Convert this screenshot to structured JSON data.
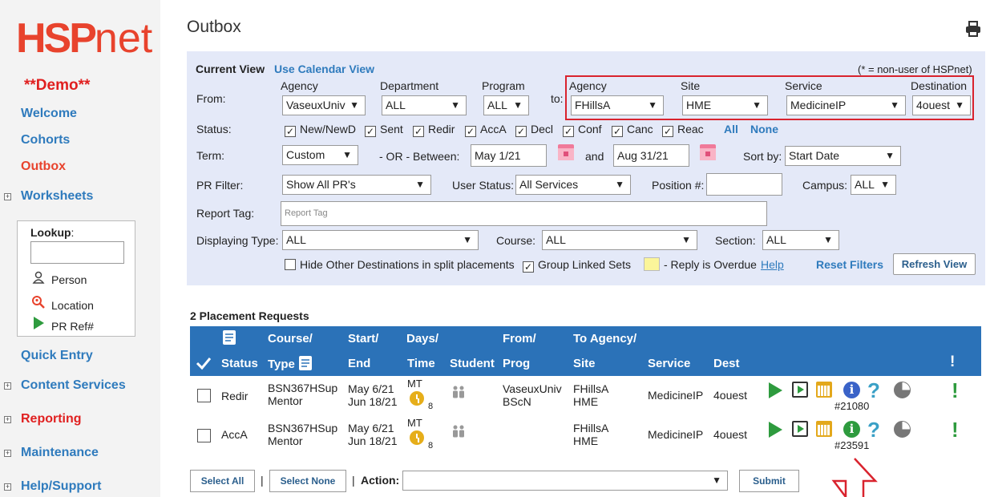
{
  "sidebar": {
    "logo_main": "HSP",
    "logo_net": "net",
    "demo": "**Demo**",
    "nav": {
      "welcome": "Welcome",
      "cohorts": "Cohorts",
      "outbox": "Outbox",
      "worksheets": "Worksheets",
      "quick_entry": "Quick Entry",
      "content_services": "Content Services",
      "reporting": "Reporting",
      "maintenance": "Maintenance",
      "help_support": "Help/Support"
    },
    "lookup": {
      "title": "Lookup",
      "colon": ":",
      "items": [
        "Person",
        "Location",
        "PR Ref#"
      ]
    }
  },
  "page": {
    "title": "Outbox"
  },
  "filters": {
    "current_view": "Current View",
    "calendar_link": "Use Calendar View",
    "non_user_note": "(* = non-user of HSPnet)",
    "from_label": "From:",
    "to_label": "to:",
    "agency_label": "Agency",
    "department_label": "Department",
    "program_label": "Program",
    "to_agency_label": "Agency",
    "site_label": "Site",
    "service_label": "Service",
    "destination_label": "Destination",
    "from_agency": "VaseuxUniv",
    "department": "ALL",
    "program": "ALL",
    "to_agency": "FHillsA",
    "site": "HME",
    "service": "MedicineIP",
    "destination": "4ouest",
    "status_label": "Status:",
    "statuses": [
      "New/NewD",
      "Sent",
      "Redir",
      "AccA",
      "Decl",
      "Conf",
      "Canc",
      "Reac"
    ],
    "all_link": "All",
    "none_link": "None",
    "term_label": "Term:",
    "term": "Custom",
    "or_between": "- OR -  Between:",
    "date_from": "May 1/21",
    "and_label": "and",
    "date_to": "Aug 31/21",
    "sort_label": "Sort by:",
    "sort": "Start Date",
    "pr_filter_label": "PR Filter:",
    "pr_filter": "Show All PR's",
    "user_status_label": "User Status:",
    "user_status": "All Services",
    "position_label": "Position #:",
    "position_value": "",
    "campus_label": "Campus:",
    "campus": "ALL",
    "report_tag_label": "Report Tag:",
    "report_tag_placeholder": "Report Tag",
    "displaying_type_label": "Displaying Type:",
    "displaying_type": "ALL",
    "course_label": "Course:",
    "course": "ALL",
    "section_label": "Section:",
    "section": "ALL",
    "hide_other": "Hide Other Destinations in split placements",
    "group_linked": "Group Linked Sets",
    "overdue_note": "- Reply is Overdue",
    "help_link": "Help",
    "reset_filters": "Reset Filters",
    "refresh_view": "Refresh View"
  },
  "results": {
    "count_label": "2 Placement Requests",
    "headers": {
      "status": "Status",
      "course": "Course/",
      "type": "Type",
      "start": "Start/",
      "end": "End",
      "days": "Days/",
      "time": "Time",
      "student": "Student",
      "from": "From/",
      "prog": "Prog",
      "to_agency": "To Agency/",
      "site": "Site",
      "service": "Service",
      "dest": "Dest",
      "flag": "!"
    },
    "rows": [
      {
        "status": "Redir",
        "course": "BSN367HSup",
        "type": "Mentor",
        "start": "May 6/21",
        "end": "Jun 18/21",
        "days": "MT",
        "hours": "8",
        "from": "VaseuxUniv",
        "prog": "BScN",
        "to_agency": "FHillsA",
        "site": "HME",
        "service": "MedicineIP",
        "dest": "4ouest",
        "ref": "#21080",
        "info_color": "#3a63c8"
      },
      {
        "status": "AccA",
        "course": "BSN367HSup",
        "type": "Mentor",
        "start": "May 6/21",
        "end": "Jun 18/21",
        "days": "MT",
        "hours": "8",
        "from": "",
        "prog": "",
        "to_agency": "FHillsA",
        "site": "HME",
        "service": "MedicineIP",
        "dest": "4ouest",
        "ref": "#23591",
        "info_color": "#2e9b3e"
      }
    ]
  },
  "actions": {
    "select_all": "Select All",
    "sep1": "|",
    "select_none": "Select None",
    "sep2": "|",
    "action_label": "Action:",
    "action_value": "",
    "submit": "Submit"
  },
  "colors": {
    "brand": "#e8432d",
    "link": "#2f7bbd",
    "header_bg": "#2b72b8",
    "filter_bg": "#e4e9f8",
    "highlight": "#d9232e"
  }
}
